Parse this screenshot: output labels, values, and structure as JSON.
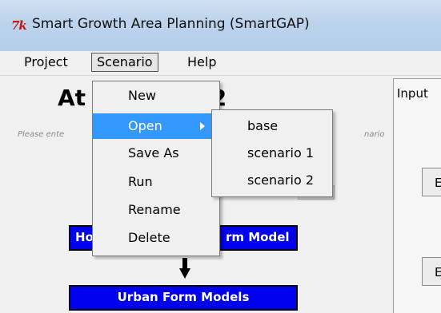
{
  "window": {
    "title": "Smart Growth Area Planning (SmartGAP)",
    "icon": "tk-feather-icon"
  },
  "menubar": {
    "items": [
      {
        "label": "Project"
      },
      {
        "label": "Scenario"
      },
      {
        "label": "Help"
      }
    ]
  },
  "main": {
    "heading": "At Scenario 2",
    "hint_left": "Please ente",
    "hint_right": "nario",
    "btn_top_left": "Ho",
    "btn_top_right": "rm Model",
    "btn_bottom": "Urban Form Models"
  },
  "panel": {
    "tab": "Input",
    "btn1": "E",
    "btn2": "E"
  },
  "scenario_menu": {
    "items": [
      {
        "label": "New"
      },
      {
        "label": "Open"
      },
      {
        "label": "Save As"
      },
      {
        "label": "Run"
      },
      {
        "label": "Rename"
      },
      {
        "label": "Delete"
      }
    ]
  },
  "open_submenu": {
    "items": [
      {
        "label": "base"
      },
      {
        "label": "scenario 1"
      },
      {
        "label": "scenario 2"
      }
    ]
  },
  "colors": {
    "highlight": "#3399ff",
    "button_blue": "#0000ee"
  }
}
